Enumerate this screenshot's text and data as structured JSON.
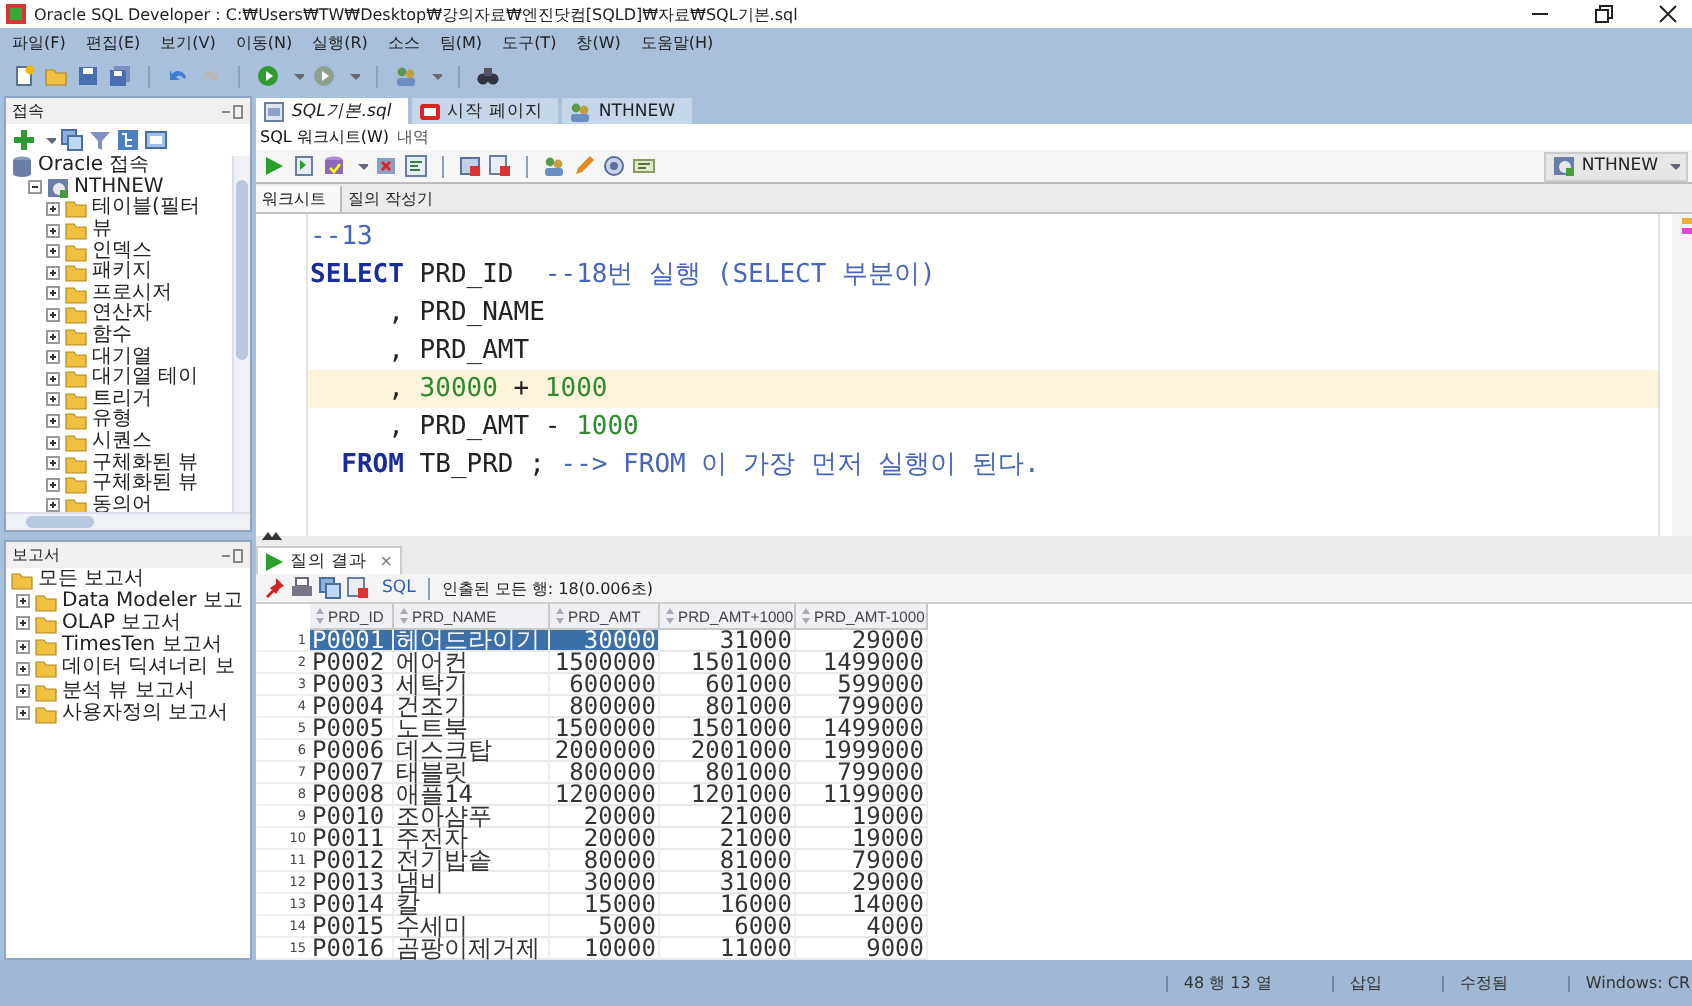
{
  "window": {
    "title": "Oracle SQL Developer : C:₩Users₩TW₩Desktop₩강의자료₩엔진닷컴[SQLD]₩자료₩SQL기본.sql"
  },
  "menu": [
    "파일(F)",
    "편집(E)",
    "보기(V)",
    "이동(N)",
    "실행(R)",
    "소스",
    "팀(M)",
    "도구(T)",
    "창(W)",
    "도움말(H)"
  ],
  "connections": {
    "title": "접속",
    "tree": [
      {
        "label": "Oracle 접속",
        "kind": "connections-root",
        "children": [
          {
            "label": "NTHNEW",
            "kind": "connection",
            "expanded": true,
            "children": [
              {
                "label": "테이블(필터",
                "kind": "folder",
                "expanded": false
              },
              {
                "label": "뷰",
                "kind": "folder",
                "expanded": false
              },
              {
                "label": "인덱스",
                "kind": "folder",
                "expanded": false
              },
              {
                "label": "패키지",
                "kind": "folder",
                "expanded": false
              },
              {
                "label": "프로시저",
                "kind": "folder",
                "expanded": false
              },
              {
                "label": "연산자",
                "kind": "folder",
                "expanded": false
              },
              {
                "label": "함수",
                "kind": "folder",
                "expanded": false
              },
              {
                "label": "대기열",
                "kind": "folder",
                "expanded": false
              },
              {
                "label": "대기열 테이",
                "kind": "folder",
                "expanded": false
              },
              {
                "label": "트리거",
                "kind": "folder",
                "expanded": false
              },
              {
                "label": "유형",
                "kind": "folder",
                "expanded": false
              },
              {
                "label": "시퀀스",
                "kind": "folder",
                "expanded": false
              },
              {
                "label": "구체화된 뷰",
                "kind": "folder",
                "expanded": false
              },
              {
                "label": "구체화된 뷰",
                "kind": "folder",
                "expanded": false
              },
              {
                "label": "동의어",
                "kind": "folder",
                "expanded": false
              }
            ]
          }
        ]
      }
    ]
  },
  "reports": {
    "title": "보고서",
    "tree": [
      {
        "label": "모든 보고서",
        "kind": "reports-root",
        "children": [
          {
            "label": "Data Modeler 보고",
            "kind": "folder",
            "expanded": false
          },
          {
            "label": "OLAP 보고서",
            "kind": "folder",
            "expanded": false
          },
          {
            "label": "TimesTen 보고서",
            "kind": "folder",
            "expanded": false
          },
          {
            "label": "데이터 딕셔너리 보",
            "kind": "folder",
            "expanded": false
          },
          {
            "label": "분석 뷰 보고서",
            "kind": "folder",
            "expanded": false
          },
          {
            "label": "사용자정의 보고서",
            "kind": "folder",
            "expanded": false
          }
        ]
      }
    ]
  },
  "editor_tabs": [
    {
      "label": "SQL기본.sql",
      "kind": "sql",
      "selected": true
    },
    {
      "label": "시작 페이지",
      "kind": "start",
      "selected": false
    },
    {
      "label": "NTHNEW",
      "kind": "connection",
      "selected": false
    }
  ],
  "sub_tabs": [
    {
      "label": "SQL 워크시트(W)",
      "selected": true
    },
    {
      "label": "내역",
      "selected": false
    }
  ],
  "connection_picker": {
    "label": "NTHNEW"
  },
  "worksheet_tabs": [
    {
      "label": "워크시트",
      "selected": true
    },
    {
      "label": "질의 작성기",
      "selected": false
    }
  ],
  "code_lines": [
    {
      "current": false,
      "tokens": [
        {
          "text": "--13",
          "kind": "comment"
        }
      ]
    },
    {
      "current": false,
      "tokens": [
        {
          "text": "SELECT",
          "kind": "keyword"
        },
        {
          "text": " PRD_ID  ",
          "kind": "plain"
        },
        {
          "text": "--18번 실행 (SELECT 부분이)",
          "kind": "comment"
        }
      ]
    },
    {
      "current": false,
      "tokens": [
        {
          "text": "     , PRD_NAME",
          "kind": "plain"
        }
      ]
    },
    {
      "current": false,
      "tokens": [
        {
          "text": "     , PRD_AMT",
          "kind": "plain"
        }
      ]
    },
    {
      "current": true,
      "tokens": [
        {
          "text": "     , ",
          "kind": "plain"
        },
        {
          "text": "30000",
          "kind": "number"
        },
        {
          "text": " + ",
          "kind": "plain"
        },
        {
          "text": "1000",
          "kind": "number"
        }
      ]
    },
    {
      "current": false,
      "tokens": [
        {
          "text": "     , PRD_AMT - ",
          "kind": "plain"
        },
        {
          "text": "1000",
          "kind": "number"
        }
      ]
    },
    {
      "current": false,
      "tokens": [
        {
          "text": "  FROM",
          "kind": "keyword"
        },
        {
          "text": " TB_PRD ; ",
          "kind": "plain"
        },
        {
          "text": "--> FROM 이 가장 먼저 실행이 된다.",
          "kind": "comment"
        }
      ]
    }
  ],
  "results": {
    "tab": {
      "label": "질의 결과",
      "close": "×"
    },
    "sql_link": "SQL",
    "fetch_status": "인출된 모든 행: 18(0.006초)",
    "columns": [
      {
        "label": "PRD_ID",
        "kind": "text"
      },
      {
        "label": "PRD_NAME",
        "kind": "text"
      },
      {
        "label": "PRD_AMT",
        "kind": "number"
      },
      {
        "label": "PRD_AMT+1000",
        "kind": "number"
      },
      {
        "label": "PRD_AMT-1000",
        "kind": "number"
      }
    ],
    "rows": [
      {
        "num": "1",
        "cells": [
          {
            "text": "P0001",
            "selected": true
          },
          {
            "text": "헤어드라이기",
            "selected": true
          },
          {
            "text": "30000",
            "selected": true
          },
          {
            "text": "31000",
            "selected": false
          },
          {
            "text": "29000",
            "selected": false
          }
        ]
      },
      {
        "num": "2",
        "cells": [
          {
            "text": "P0002",
            "selected": false
          },
          {
            "text": "에어컨",
            "selected": false
          },
          {
            "text": "1500000",
            "selected": false
          },
          {
            "text": "1501000",
            "selected": false
          },
          {
            "text": "1499000",
            "selected": false
          }
        ]
      },
      {
        "num": "3",
        "cells": [
          {
            "text": "P0003",
            "selected": false
          },
          {
            "text": "세탁기",
            "selected": false
          },
          {
            "text": "600000",
            "selected": false
          },
          {
            "text": "601000",
            "selected": false
          },
          {
            "text": "599000",
            "selected": false
          }
        ]
      },
      {
        "num": "4",
        "cells": [
          {
            "text": "P0004",
            "selected": false
          },
          {
            "text": "건조기",
            "selected": false
          },
          {
            "text": "800000",
            "selected": false
          },
          {
            "text": "801000",
            "selected": false
          },
          {
            "text": "799000",
            "selected": false
          }
        ]
      },
      {
        "num": "5",
        "cells": [
          {
            "text": "P0005",
            "selected": false
          },
          {
            "text": "노트북",
            "selected": false
          },
          {
            "text": "1500000",
            "selected": false
          },
          {
            "text": "1501000",
            "selected": false
          },
          {
            "text": "1499000",
            "selected": false
          }
        ]
      },
      {
        "num": "6",
        "cells": [
          {
            "text": "P0006",
            "selected": false
          },
          {
            "text": "데스크탑",
            "selected": false
          },
          {
            "text": "2000000",
            "selected": false
          },
          {
            "text": "2001000",
            "selected": false
          },
          {
            "text": "1999000",
            "selected": false
          }
        ]
      },
      {
        "num": "7",
        "cells": [
          {
            "text": "P0007",
            "selected": false
          },
          {
            "text": "태블릿",
            "selected": false
          },
          {
            "text": "800000",
            "selected": false
          },
          {
            "text": "801000",
            "selected": false
          },
          {
            "text": "799000",
            "selected": false
          }
        ]
      },
      {
        "num": "8",
        "cells": [
          {
            "text": "P0008",
            "selected": false
          },
          {
            "text": "애플14",
            "selected": false
          },
          {
            "text": "1200000",
            "selected": false
          },
          {
            "text": "1201000",
            "selected": false
          },
          {
            "text": "1199000",
            "selected": false
          }
        ]
      },
      {
        "num": "9",
        "cells": [
          {
            "text": "P0010",
            "selected": false
          },
          {
            "text": "조아샴푸",
            "selected": false
          },
          {
            "text": "20000",
            "selected": false
          },
          {
            "text": "21000",
            "selected": false
          },
          {
            "text": "19000",
            "selected": false
          }
        ]
      },
      {
        "num": "10",
        "cells": [
          {
            "text": "P0011",
            "selected": false
          },
          {
            "text": "주전자",
            "selected": false
          },
          {
            "text": "20000",
            "selected": false
          },
          {
            "text": "21000",
            "selected": false
          },
          {
            "text": "19000",
            "selected": false
          }
        ]
      },
      {
        "num": "11",
        "cells": [
          {
            "text": "P0012",
            "selected": false
          },
          {
            "text": "전기밥솥",
            "selected": false
          },
          {
            "text": "80000",
            "selected": false
          },
          {
            "text": "81000",
            "selected": false
          },
          {
            "text": "79000",
            "selected": false
          }
        ]
      },
      {
        "num": "12",
        "cells": [
          {
            "text": "P0013",
            "selected": false
          },
          {
            "text": "냄비",
            "selected": false
          },
          {
            "text": "30000",
            "selected": false
          },
          {
            "text": "31000",
            "selected": false
          },
          {
            "text": "29000",
            "selected": false
          }
        ]
      },
      {
        "num": "13",
        "cells": [
          {
            "text": "P0014",
            "selected": false
          },
          {
            "text": "칼",
            "selected": false
          },
          {
            "text": "15000",
            "selected": false
          },
          {
            "text": "16000",
            "selected": false
          },
          {
            "text": "14000",
            "selected": false
          }
        ]
      },
      {
        "num": "14",
        "cells": [
          {
            "text": "P0015",
            "selected": false
          },
          {
            "text": "수세미",
            "selected": false
          },
          {
            "text": "5000",
            "selected": false
          },
          {
            "text": "6000",
            "selected": false
          },
          {
            "text": "4000",
            "selected": false
          }
        ]
      },
      {
        "num": "15",
        "cells": [
          {
            "text": "P0016",
            "selected": false
          },
          {
            "text": "곰팡이제거제",
            "selected": false
          },
          {
            "text": "10000",
            "selected": false
          },
          {
            "text": "11000",
            "selected": false
          },
          {
            "text": "9000",
            "selected": false
          }
        ]
      }
    ]
  },
  "status_bar": [
    "48 행 13 열",
    "삽입",
    "수정됨",
    "Windows: CR"
  ]
}
